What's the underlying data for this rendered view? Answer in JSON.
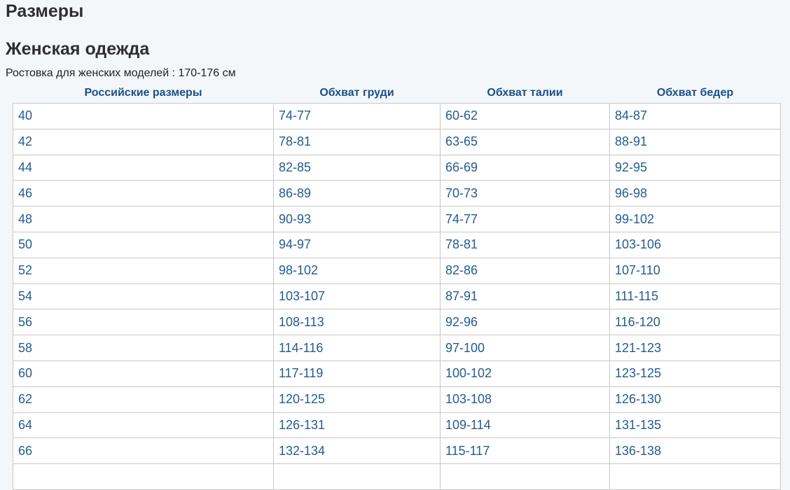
{
  "page": {
    "title": "Размеры",
    "section_title": "Женская одежда",
    "subtitle": "Ростовка для женских моделей : 170-176 см"
  },
  "table": {
    "headers": [
      "Российские размеры",
      "Обхват груди",
      "Обхват талии",
      "Обхват бедер"
    ],
    "rows": [
      [
        "40",
        "74-77",
        "60-62",
        "84-87"
      ],
      [
        "42",
        "78-81",
        "63-65",
        "88-91"
      ],
      [
        "44",
        "82-85",
        "66-69",
        "92-95"
      ],
      [
        "46",
        "86-89",
        "70-73",
        "96-98"
      ],
      [
        "48",
        "90-93",
        "74-77",
        "99-102"
      ],
      [
        "50",
        "94-97",
        "78-81",
        "103-106"
      ],
      [
        "52",
        "98-102",
        "82-86",
        "107-110"
      ],
      [
        "54",
        "103-107",
        "87-91",
        "111-115"
      ],
      [
        "56",
        "108-113",
        "92-96",
        "116-120"
      ],
      [
        "58",
        "114-116",
        "97-100",
        "121-123"
      ],
      [
        "60",
        "117-119",
        "100-102",
        "123-125"
      ],
      [
        "62",
        "120-125",
        "103-108",
        "126-130"
      ],
      [
        "64",
        "126-131",
        "109-114",
        "131-135"
      ],
      [
        "66",
        "132-134",
        "115-117",
        "136-138"
      ],
      [
        "",
        "",
        "",
        ""
      ]
    ]
  }
}
